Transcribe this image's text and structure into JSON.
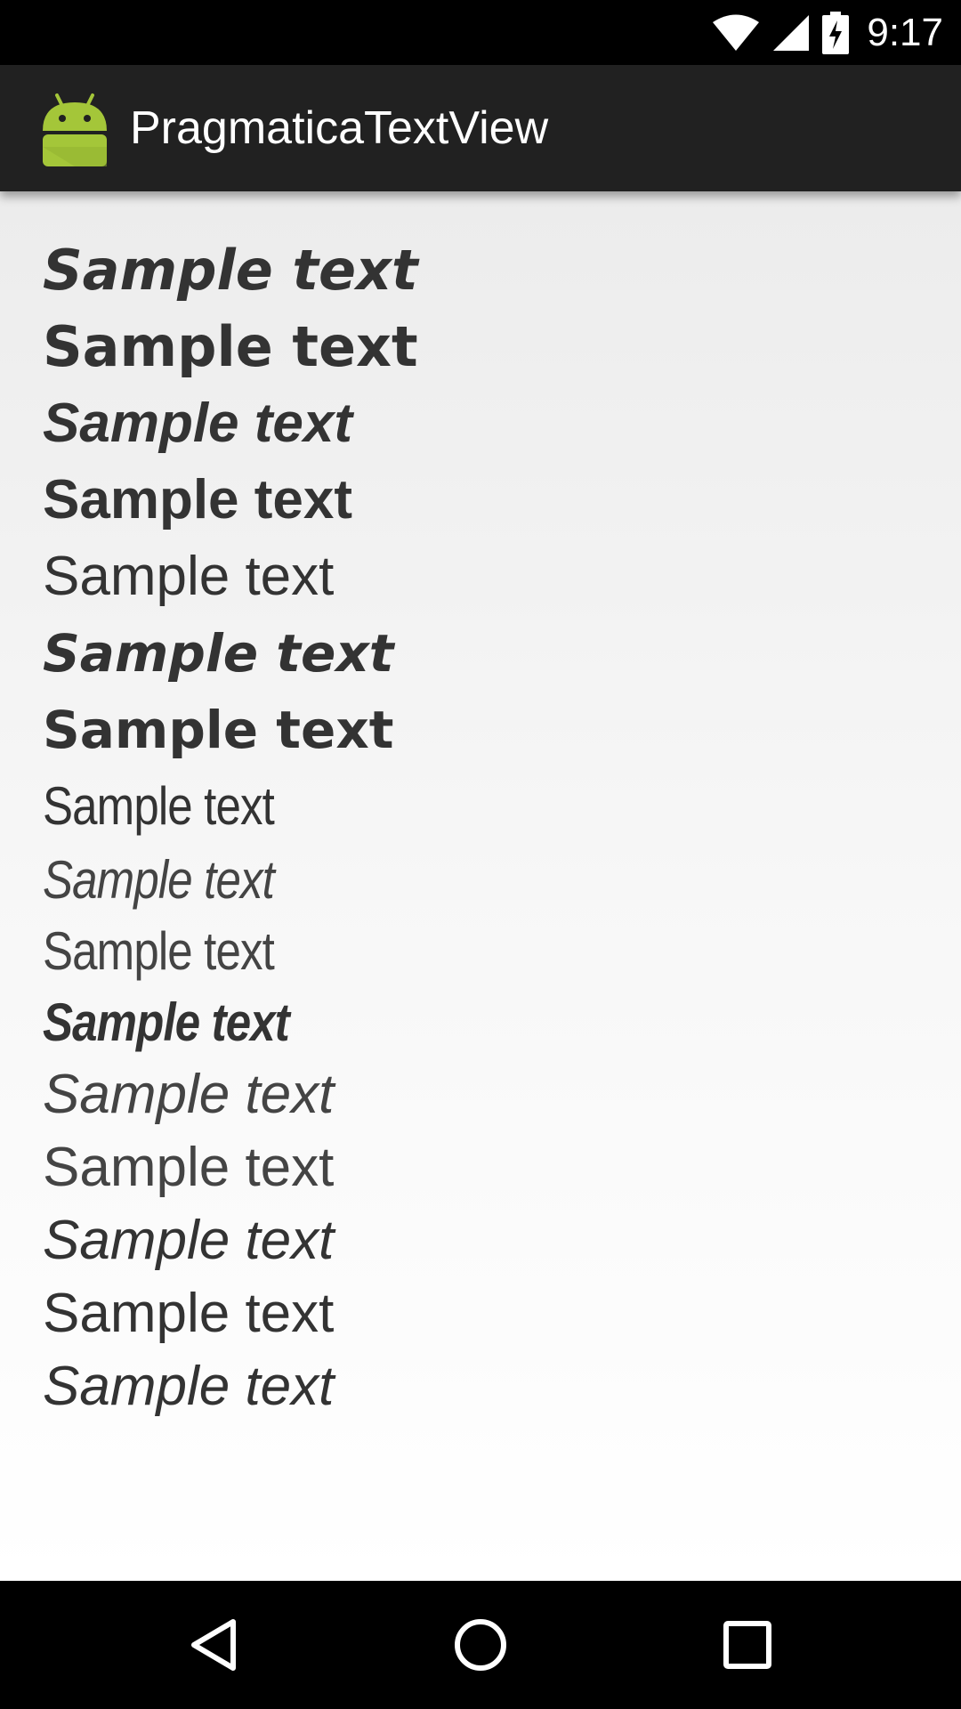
{
  "status_bar": {
    "time": "9:17",
    "icons": [
      "wifi-icon",
      "cell-signal-icon",
      "battery-charging-icon"
    ]
  },
  "action_bar": {
    "title": "PragmaticaTextView",
    "icon": "android-icon",
    "icon_color": "#a4c639"
  },
  "samples": [
    {
      "text": "Sample text",
      "style": "black italic"
    },
    {
      "text": "Sample text",
      "style": "black"
    },
    {
      "text": "Sample text",
      "style": "bold italic"
    },
    {
      "text": "Sample text",
      "style": "bold"
    },
    {
      "text": "Sample text",
      "style": "regular"
    },
    {
      "text": "Sample text",
      "style": "black italic"
    },
    {
      "text": "Sample text",
      "style": "black"
    },
    {
      "text": "Sample text",
      "style": "condensed"
    },
    {
      "text": "Sample text",
      "style": "condensed light italic"
    },
    {
      "text": "Sample text",
      "style": "condensed light"
    },
    {
      "text": "Sample text",
      "style": "condensed bold italic"
    },
    {
      "text": "Sample text",
      "style": "light italic"
    },
    {
      "text": "Sample text",
      "style": "light"
    },
    {
      "text": "Sample text",
      "style": "italic"
    },
    {
      "text": "Sample text",
      "style": "regular"
    },
    {
      "text": "Sample text",
      "style": "medium italic"
    }
  ],
  "nav_bar": {
    "buttons": [
      "back-icon",
      "home-icon",
      "recents-icon"
    ]
  }
}
